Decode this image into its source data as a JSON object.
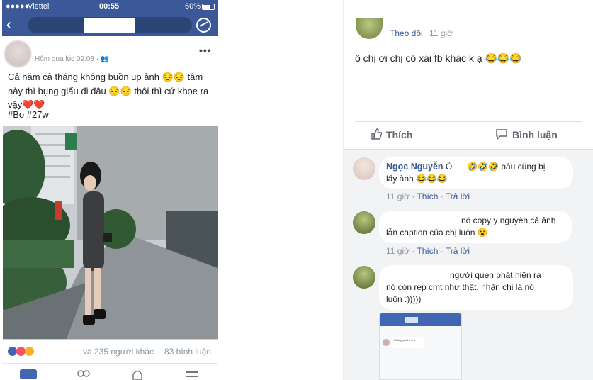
{
  "left_post": {
    "status_bar": {
      "carrier": "Viettel",
      "time": "00:55",
      "battery": "60%"
    },
    "post_time": "Hôm qua lúc 09:08 · 👥",
    "menu_icon": "•••",
    "text": "Cả năm cả tháng không buồn up ảnh 😔😔 tầm này thì bụng giấu đi đâu 😔😔 thôi thì cứ khoe ra vậy❤️❤️",
    "tags": "#Bo #27w",
    "reactions_text": "và 235 người khác",
    "comments_count": "83 bình luận"
  },
  "right_thread": {
    "follow_label": "Theo dõi",
    "follow_time": "11 giờ",
    "post_text": "ô chị ơi chị có xài fb khác k ạ 😂😂😂",
    "like_label": "Thích",
    "comment_label": "Bình luận",
    "comments": [
      {
        "name": "Ngọc Nguyễn",
        "text_line1": "Ô ⠀⠀🤣🤣🤣 bầu cũng bị",
        "text_line2": "lấy ảnh 😂😂😂",
        "time": "11 giờ",
        "like": "Thích",
        "reply": "Trả lời"
      },
      {
        "text_line1": "nó copy y nguyên cả ảnh",
        "text_line2": "lẫn caption của chị luôn 😮",
        "time": "11 giờ",
        "like": "Thích",
        "reply": "Trả lời"
      },
      {
        "text_line1": "người quen phát hiện ra",
        "text_line2": "nó còn rep cmt như thật, nhận chị là nó",
        "text_line3": "luôn :)))))"
      }
    ],
    "attachment": {
      "comment_text": "Không phải em ạ"
    }
  },
  "colors": {
    "facebook_blue": "#3b5998",
    "link_blue": "#385898",
    "comment_bg": "#f2f3f5"
  },
  "icons": {
    "messenger": "messenger-icon",
    "back": "back-chevron-icon",
    "like": "thumbs-up-icon",
    "comment": "speech-bubble-icon"
  }
}
